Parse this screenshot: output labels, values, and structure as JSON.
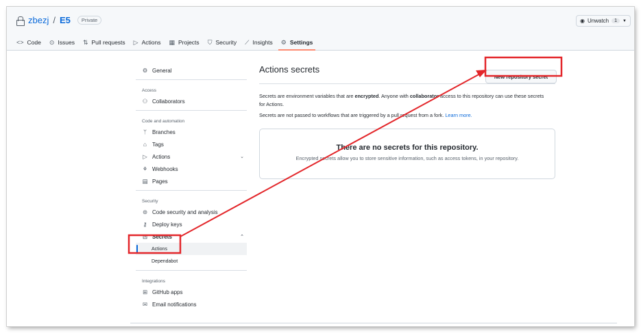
{
  "repo": {
    "owner": "zbezj",
    "name": "E5",
    "visibility": "Private"
  },
  "watch": {
    "label": "Unwatch",
    "count": "1"
  },
  "tabs": [
    {
      "label": "Code",
      "icon": "code-icon"
    },
    {
      "label": "Issues",
      "icon": "issue-icon"
    },
    {
      "label": "Pull requests",
      "icon": "pull-request-icon"
    },
    {
      "label": "Actions",
      "icon": "play-icon"
    },
    {
      "label": "Projects",
      "icon": "table-icon"
    },
    {
      "label": "Security",
      "icon": "shield-icon"
    },
    {
      "label": "Insights",
      "icon": "graph-icon"
    },
    {
      "label": "Settings",
      "icon": "gear-icon",
      "active": true
    }
  ],
  "sidebar": {
    "general": "General",
    "access_heading": "Access",
    "collaborators": "Collaborators",
    "code_heading": "Code and automation",
    "branches": "Branches",
    "tags": "Tags",
    "actions": "Actions",
    "webhooks": "Webhooks",
    "pages": "Pages",
    "security_heading": "Security",
    "code_security": "Code security and analysis",
    "deploy_keys": "Deploy keys",
    "secrets": "Secrets",
    "secrets_actions": "Actions",
    "secrets_dependabot": "Dependabot",
    "integrations_heading": "Integrations",
    "github_apps": "GitHub apps",
    "email_notifications": "Email notifications"
  },
  "main": {
    "title": "Actions secrets",
    "new_button": "New repository secret",
    "p1_a": "Secrets are environment variables that are ",
    "p1_b": "encrypted",
    "p1_c": ". Anyone with ",
    "p1_d": "collaborator",
    "p1_e": " access to this repository can use these secrets for Actions.",
    "p2": "Secrets are not passed to workflows that are triggered by a pull request from a fork. ",
    "learn_more": "Learn more.",
    "empty_title": "There are no secrets for this repository.",
    "empty_desc": "Encrypted secrets allow you to store sensitive information, such as access tokens, in your repository."
  },
  "colors": {
    "annotation": "#e3262a",
    "link": "#0969da",
    "tab_underline": "#fd8c73"
  }
}
